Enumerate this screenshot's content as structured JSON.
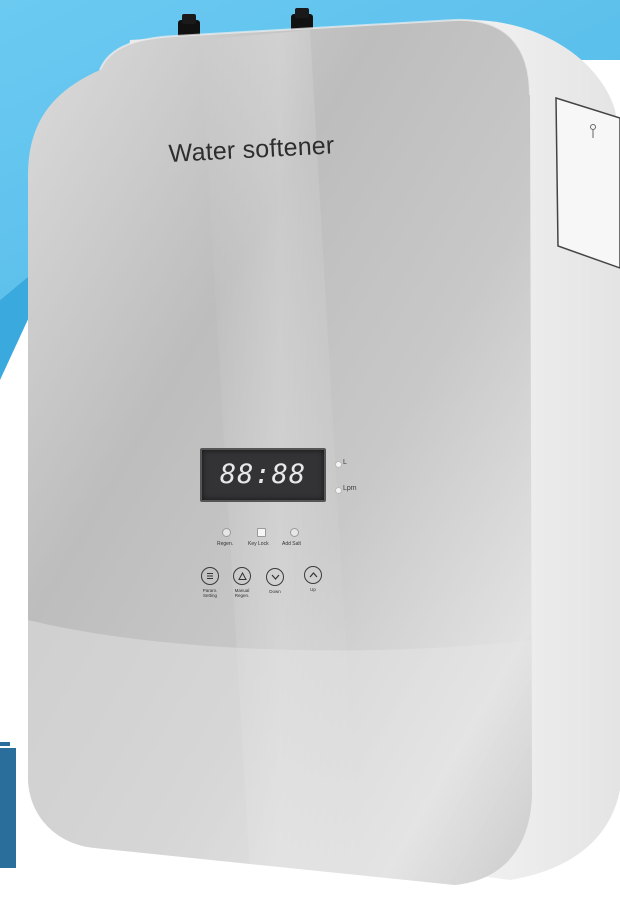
{
  "product": {
    "name": "Water softener"
  },
  "display": {
    "readout": "88:88",
    "units": [
      "L",
      "Lpm"
    ]
  },
  "indicators": [
    {
      "label": "Regen.",
      "icon": "circle-led-icon"
    },
    {
      "label": "Key Lock",
      "icon": "square-led-icon"
    },
    {
      "label": "Add Salt",
      "icon": "salt-led-icon"
    }
  ],
  "keys": [
    {
      "label": "Param. Setting",
      "icon": "menu-icon"
    },
    {
      "label": "Manual Regen.",
      "icon": "regen-icon"
    },
    {
      "label": "Down",
      "icon": "chevron-down-icon"
    },
    {
      "label": "Up",
      "icon": "chevron-up-icon"
    }
  ],
  "colors": {
    "background_sky": "#5bc3ee",
    "accent_blue": "#2a6e9b",
    "panel_light": "#d8d8d8",
    "panel_dark": "#a9a9a9",
    "body_white": "#f4f4f4",
    "display_bg": "#333336"
  }
}
